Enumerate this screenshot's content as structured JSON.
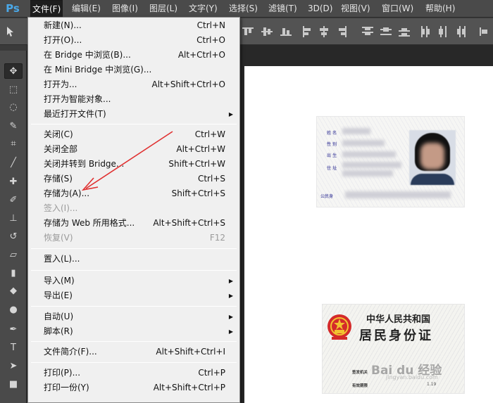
{
  "app": {
    "logo": "Ps"
  },
  "menubar": {
    "items": [
      {
        "label": "文件(F)"
      },
      {
        "label": "编辑(E)"
      },
      {
        "label": "图像(I)"
      },
      {
        "label": "图层(L)"
      },
      {
        "label": "文字(Y)"
      },
      {
        "label": "选择(S)"
      },
      {
        "label": "滤镜(T)"
      },
      {
        "label": "3D(D)"
      },
      {
        "label": "视图(V)"
      },
      {
        "label": "窗口(W)"
      },
      {
        "label": "帮助(H)"
      }
    ],
    "active": "文件(F)"
  },
  "file_menu": {
    "items": [
      {
        "label": "新建(N)...",
        "shortcut": "Ctrl+N"
      },
      {
        "label": "打开(O)...",
        "shortcut": "Ctrl+O"
      },
      {
        "label": "在 Bridge 中浏览(B)...",
        "shortcut": "Alt+Ctrl+O"
      },
      {
        "label": "在 Mini Bridge 中浏览(G)...",
        "shortcut": ""
      },
      {
        "label": "打开为...",
        "shortcut": "Alt+Shift+Ctrl+O"
      },
      {
        "label": "打开为智能对象...",
        "shortcut": ""
      },
      {
        "label": "最近打开文件(T)",
        "shortcut": "",
        "submenu": true
      },
      {
        "label": "关闭(C)",
        "shortcut": "Ctrl+W"
      },
      {
        "label": "关闭全部",
        "shortcut": "Alt+Ctrl+W"
      },
      {
        "label": "关闭并转到 Bridge...",
        "shortcut": "Shift+Ctrl+W"
      },
      {
        "label": "存储(S)",
        "shortcut": "Ctrl+S"
      },
      {
        "label": "存储为(A)...",
        "shortcut": "Shift+Ctrl+S"
      },
      {
        "label": "签入(I)...",
        "shortcut": "",
        "disabled": true
      },
      {
        "label": "存储为 Web 所用格式...",
        "shortcut": "Alt+Shift+Ctrl+S"
      },
      {
        "label": "恢复(V)",
        "shortcut": "F12",
        "disabled": true
      },
      {
        "label": "置入(L)...",
        "shortcut": ""
      },
      {
        "label": "导入(M)",
        "shortcut": "",
        "submenu": true
      },
      {
        "label": "导出(E)",
        "shortcut": "",
        "submenu": true
      },
      {
        "label": "自动(U)",
        "shortcut": "",
        "submenu": true
      },
      {
        "label": "脚本(R)",
        "shortcut": "",
        "submenu": true
      },
      {
        "label": "文件简介(F)...",
        "shortcut": "Alt+Shift+Ctrl+I"
      },
      {
        "label": "打印(P)...",
        "shortcut": "Ctrl+P"
      },
      {
        "label": "打印一份(Y)",
        "shortcut": "Alt+Shift+Ctrl+P"
      }
    ],
    "submenu_glyph": "▶"
  },
  "tools": {
    "items": [
      {
        "name": "move-tool-icon",
        "glyph": "✥"
      },
      {
        "name": "marquee-tool-icon",
        "glyph": "⬚"
      },
      {
        "name": "lasso-tool-icon",
        "glyph": "◌"
      },
      {
        "name": "quick-selection-tool-icon",
        "glyph": "✎"
      },
      {
        "name": "crop-tool-icon",
        "glyph": "⌗"
      },
      {
        "name": "eyedropper-tool-icon",
        "glyph": "╱"
      },
      {
        "name": "healing-brush-tool-icon",
        "glyph": "✚"
      },
      {
        "name": "brush-tool-icon",
        "glyph": "✐"
      },
      {
        "name": "clone-stamp-tool-icon",
        "glyph": "⊥"
      },
      {
        "name": "history-brush-tool-icon",
        "glyph": "↺"
      },
      {
        "name": "eraser-tool-icon",
        "glyph": "▱"
      },
      {
        "name": "gradient-tool-icon",
        "glyph": "▮"
      },
      {
        "name": "blur-tool-icon",
        "glyph": "◆"
      },
      {
        "name": "dodge-tool-icon",
        "glyph": "●"
      },
      {
        "name": "pen-tool-icon",
        "glyph": "✒"
      },
      {
        "name": "type-tool-icon",
        "glyph": "T"
      },
      {
        "name": "path-selection-tool-icon",
        "glyph": "➤"
      },
      {
        "name": "shape-tool-icon",
        "glyph": "■"
      }
    ]
  },
  "id_card_front": {
    "labels": [
      "姓 名",
      "性 别",
      "出 生",
      "住 址",
      "公民身"
    ]
  },
  "id_card_back": {
    "title_line1": "中华人民共和国",
    "title_line2": "居民身份证",
    "issuer_label": "签发机关",
    "validity_label": "有效期限",
    "validity_value_fragment": "1.19"
  },
  "watermark": {
    "text": "Bai du 经验",
    "sub": "jingyan.baidu.com"
  },
  "colors": {
    "annotation_arrow": "#e03030",
    "menu_bg": "#f0f0f0",
    "logo": "#4aa8e8"
  }
}
